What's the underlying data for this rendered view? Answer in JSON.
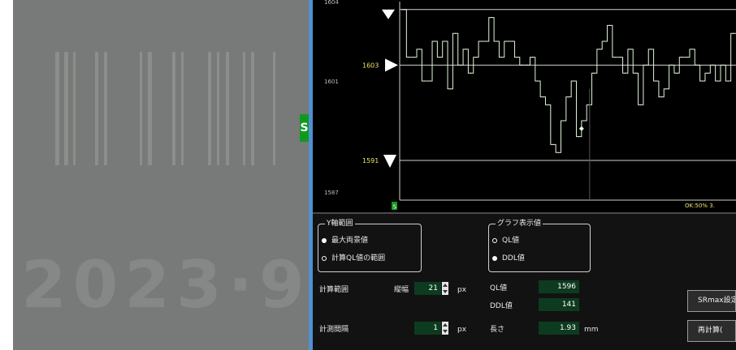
{
  "camera": {
    "stamp_text": "2023·9"
  },
  "side_tab": {
    "label": "S"
  },
  "chart_data": {
    "type": "line",
    "title": "",
    "xlabel": "",
    "ylabel": "",
    "ylim": [
      1586,
      1611
    ],
    "y_tick_labels": [
      "1604",
      "1601",
      "1587"
    ],
    "upper_limit": 1610,
    "target": 1603,
    "target_label": "1603",
    "lower_limit": 1591,
    "lower_limit_label": "1591",
    "series": [
      {
        "values": [
          1610,
          1604,
          1604,
          1605,
          1601,
          1601,
          1606,
          1604,
          1606,
          1600,
          1607,
          1603,
          1605,
          1602,
          1604,
          1606,
          1606,
          1609,
          1606,
          1604,
          1606,
          1606,
          1604,
          1603,
          1603,
          1604,
          1601,
          1599,
          1598,
          1593,
          1592,
          1596,
          1599,
          1601,
          1594,
          1596,
          1598,
          1602,
          1605,
          1606,
          1608,
          1604,
          1604,
          1602,
          1605,
          1602,
          1598,
          1603,
          1605,
          1601,
          1599,
          1600,
          1603,
          1602,
          1604,
          1604,
          1605,
          1603,
          1601,
          1602,
          1603,
          1601,
          1603,
          1601,
          1607
        ]
      }
    ],
    "marker_point": {
      "index": 35,
      "value": 1595
    },
    "status_text": "OK:50%   3."
  },
  "chart_start_marker": "S",
  "controls": {
    "y_axis_group": {
      "title": "Y軸範囲",
      "options": [
        {
          "label": "最大両景値",
          "selected": true
        },
        {
          "label": "計算QL値の範囲",
          "selected": false
        }
      ]
    },
    "graph_group": {
      "title": "グラフ表示値",
      "options": [
        {
          "label": "QL値",
          "selected": false
        },
        {
          "label": "DDL値",
          "selected": true
        }
      ]
    },
    "calc_range": {
      "label": "計算範囲",
      "sub_label": "縦幅",
      "value": "21",
      "unit": "px"
    },
    "interval": {
      "label": "計測間隔",
      "value": "1",
      "unit": "px"
    },
    "ql_value": {
      "label": "QL値",
      "value": "1596"
    },
    "ddl_value": {
      "label": "DDL値",
      "value": "141"
    },
    "length": {
      "label": "長さ",
      "value": "1.93",
      "unit": "mm"
    },
    "sr_button": {
      "label": "SRmax設定"
    },
    "recalc_button": {
      "label": "再計算("
    }
  }
}
